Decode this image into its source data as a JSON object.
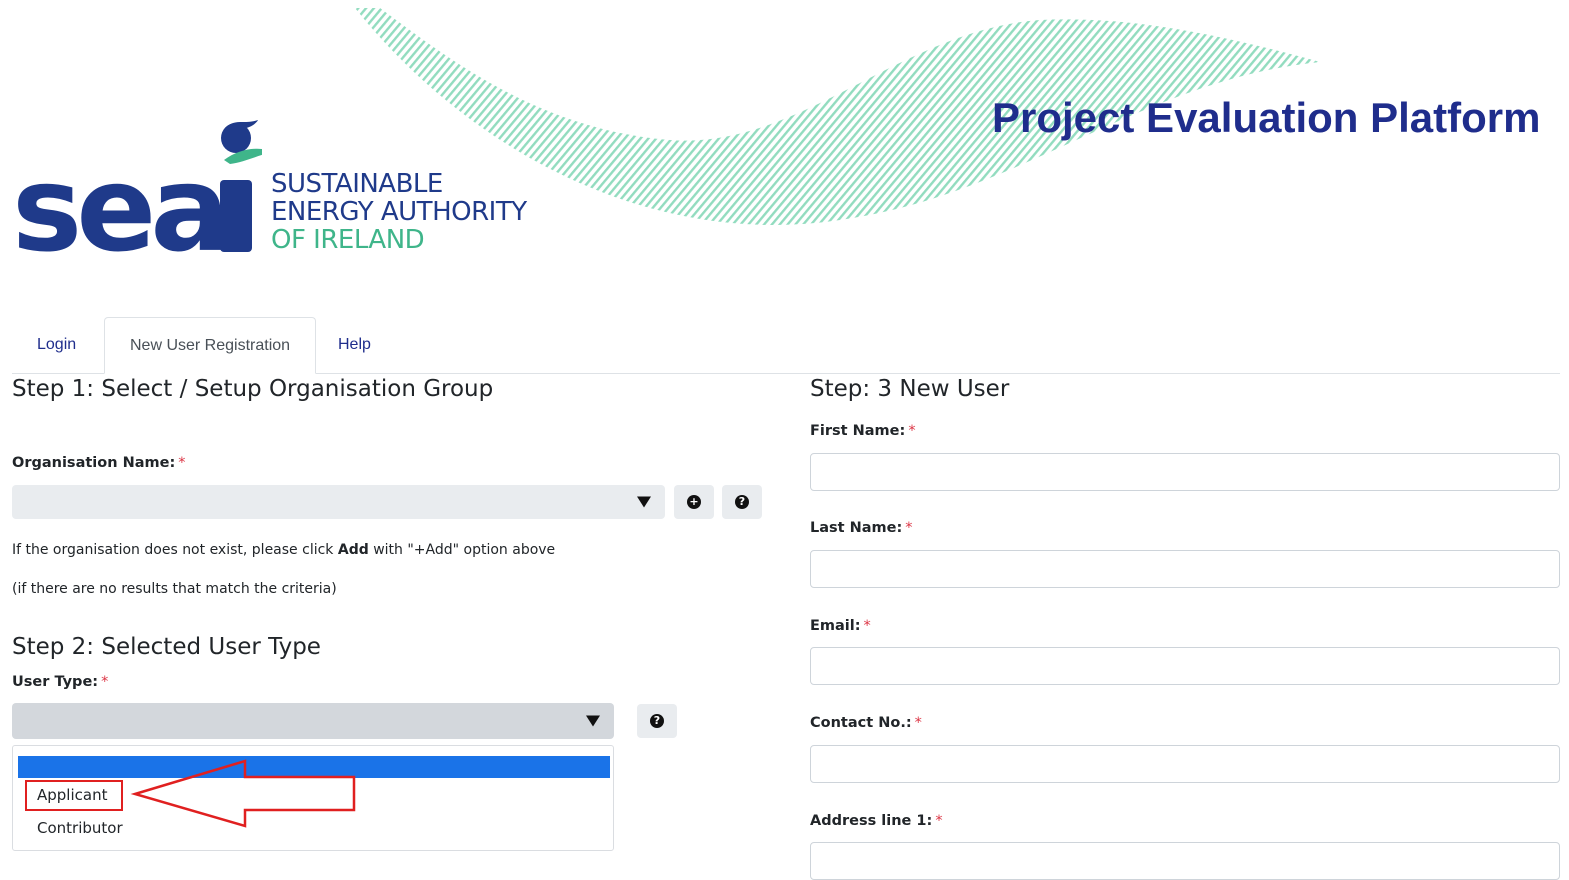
{
  "header": {
    "logo_word": "seai",
    "logo_lines": [
      "SUSTAINABLE",
      "ENERGY AUTHORITY",
      "OF IRELAND"
    ],
    "platform_title": "Project Evaluation Platform",
    "colors": {
      "navy": "#1f3a8a",
      "green": "#3fb58a",
      "title": "#1f2d8c"
    }
  },
  "tabs": [
    {
      "label": "Login",
      "active": false
    },
    {
      "label": "New User Registration",
      "active": true
    },
    {
      "label": "Help",
      "active": false
    }
  ],
  "step1": {
    "heading": "Step 1: Select / Setup Organisation Group",
    "org_label": "Organisation Name:",
    "required_mark": "*",
    "org_value": "",
    "add_icon": "plus-circle-icon",
    "help_icon": "question-circle-icon",
    "note_pre": "If the organisation does not exist, please click ",
    "note_bold": "Add",
    "note_post": " with \"+Add\" option above",
    "note2": "(if there are no results that match the criteria)"
  },
  "step2": {
    "heading": "Step 2: Selected User Type",
    "user_type_label": "User Type:",
    "required_mark": "*",
    "selected_value": "",
    "options": [
      "",
      "Applicant",
      "Contributor"
    ],
    "help_icon": "question-circle-icon"
  },
  "step3": {
    "heading": "Step: 3 New User",
    "fields": [
      {
        "label": "First Name:",
        "value": ""
      },
      {
        "label": "Last Name:",
        "value": ""
      },
      {
        "label": "Email:",
        "value": ""
      },
      {
        "label": "Contact No.:",
        "value": ""
      },
      {
        "label": "Address line 1:",
        "value": ""
      }
    ],
    "required_mark": "*"
  },
  "annotation": {
    "color": "#e02020",
    "points_to": "Applicant"
  }
}
